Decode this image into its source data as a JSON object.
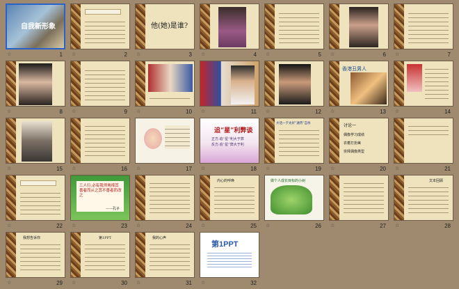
{
  "slide_numbers": [
    "1",
    "2",
    "3",
    "4",
    "5",
    "6",
    "7",
    "8",
    "9",
    "10",
    "11",
    "12",
    "13",
    "14",
    "15",
    "16",
    "17",
    "18",
    "19",
    "20",
    "21",
    "22",
    "23",
    "24",
    "25",
    "26",
    "27",
    "28",
    "29",
    "30",
    "31",
    "32"
  ],
  "slide_marker": "☆",
  "texts": {
    "s1_title": "自我新形象",
    "s3_title": "他(她)是谁?",
    "s13_caption": "香港丑男人",
    "s18_title": "追“星”利弊谈",
    "s18_line1": "正方:追“星”利大于弊",
    "s18_line2": "反方:追“星”弊大于利",
    "s19_head": "大话一夕太好“通宵”自杀",
    "s20_head": "讨论一",
    "s20_line1": "偶像学习成绩",
    "s20_line2": "衣着打扮美",
    "s20_line3": "崇拜偶像类型",
    "s23_text": "三人行,必有我师焉择其善者而从之其不善者而改之",
    "s23_sub": "——孔子",
    "s25_title": "内心的呼唤",
    "s26_title": "做个人成长目标的小树",
    "s28_title": "文本回顾",
    "s29_title": "我想告诉你",
    "s30_title": "第1PPT",
    "s31_title": "我的心声",
    "s32_logo": "第1PPT"
  },
  "colors": {
    "selection": "#2a62c9",
    "background": "#9f8a70",
    "paper": "#efe3bd",
    "accent": "#b21a1a"
  }
}
